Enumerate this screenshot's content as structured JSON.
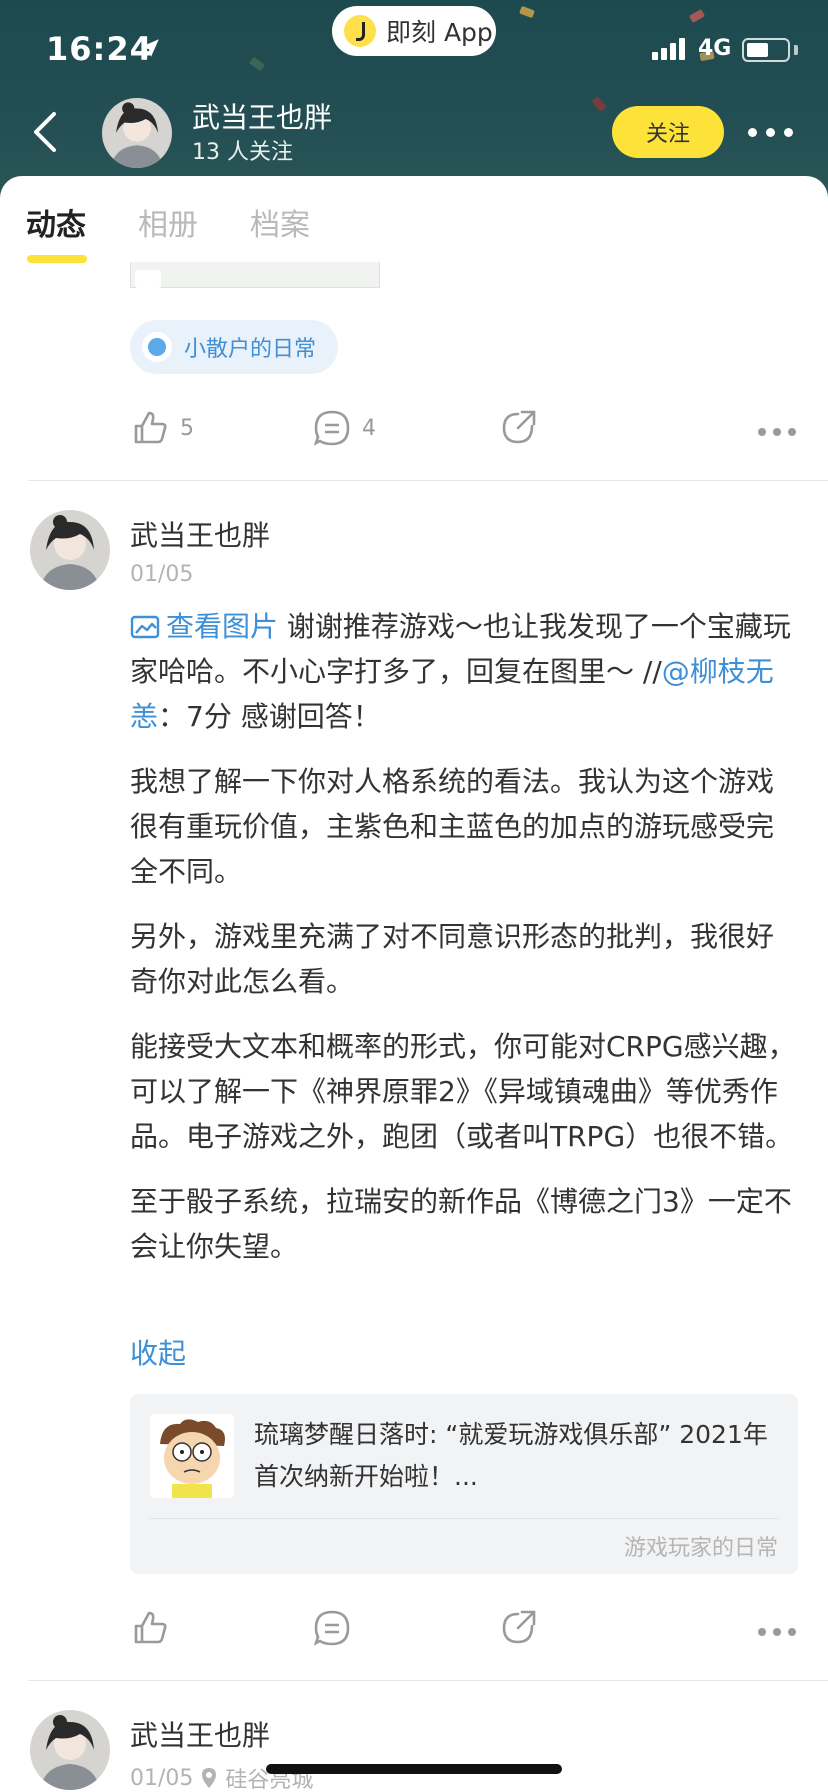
{
  "status_bar": {
    "time": "16:24",
    "app_pill": "即刻 App",
    "network": "4G",
    "battery_level": 0.55
  },
  "header": {
    "user_name": "武当王也胖",
    "followers": "13 人关注",
    "follow_label": "关注"
  },
  "tabs": [
    {
      "label": "动态",
      "active": true
    },
    {
      "label": "相册",
      "active": false
    },
    {
      "label": "档案",
      "active": false
    }
  ],
  "post1": {
    "topic": "小散户的日常",
    "like_count": "5",
    "comment_count": "4"
  },
  "post2": {
    "author": "武当王也胖",
    "date": "01/05",
    "view_pic": "查看图片",
    "lead_text": " 谢谢推荐游戏～也让我发现了一个宝藏玩家哈哈。不小心字打多了，回复在图里～ //",
    "mention": "@柳枝无恙",
    "mention_tail": "：7分 感谢回答！",
    "paragraphs": [
      "我想了解一下你对人格系统的看法。我认为这个游戏很有重玩价值，主紫色和主蓝色的加点的游玩感受完全不同。",
      "另外，游戏里充满了对不同意识形态的批判，我很好奇你对此怎么看。",
      "能接受大文本和概率的形式，你可能对CRPG感兴趣，可以了解一下《神界原罪2》《异域镇魂曲》等优秀作品。电子游戏之外，跑团（或者叫TRPG）也很不错。",
      "至于骰子系统，拉瑞安的新作品《博德之门3》一定不会让你失望。"
    ],
    "collapse_label": "收起",
    "repost": {
      "text": "琉璃梦醒日落时: “就爱玩游戏俱乐部” 2021年首次纳新开始啦！...",
      "topic": "游戏玩家的日常"
    }
  },
  "post3": {
    "author": "武当王也胖",
    "date": "01/05",
    "location": "硅谷亮城"
  }
}
